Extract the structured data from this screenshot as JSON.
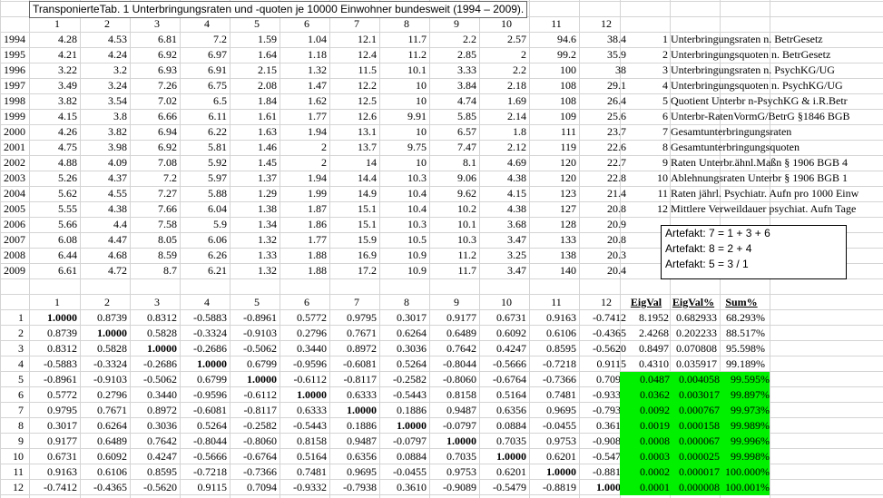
{
  "title": "TransponierteTab. 1 Unterbringungsraten und -quoten je 10000 Einwohner bundesweit (1994 – 2009).",
  "col_headers": [
    "1",
    "2",
    "3",
    "4",
    "5",
    "6",
    "7",
    "8",
    "9",
    "10",
    "11",
    "12"
  ],
  "years": [
    "1994",
    "1995",
    "1996",
    "1997",
    "1998",
    "1999",
    "2000",
    "2001",
    "2002",
    "2003",
    "2004",
    "2005",
    "2006",
    "2007",
    "2008",
    "2009"
  ],
  "data_rows": [
    [
      "4.28",
      "4.53",
      "6.81",
      "7.2",
      "1.59",
      "1.04",
      "12.1",
      "11.7",
      "2.2",
      "2.57",
      "94.6",
      "38.4"
    ],
    [
      "4.21",
      "4.24",
      "6.92",
      "6.97",
      "1.64",
      "1.18",
      "12.4",
      "11.2",
      "2.85",
      "2",
      "99.2",
      "35.9"
    ],
    [
      "3.22",
      "3.2",
      "6.93",
      "6.91",
      "2.15",
      "1.32",
      "11.5",
      "10.1",
      "3.33",
      "2.2",
      "100",
      "38"
    ],
    [
      "3.49",
      "3.24",
      "7.26",
      "6.75",
      "2.08",
      "1.47",
      "12.2",
      "10",
      "3.84",
      "2.18",
      "108",
      "29.1"
    ],
    [
      "3.82",
      "3.54",
      "7.02",
      "6.5",
      "1.84",
      "1.62",
      "12.5",
      "10",
      "4.74",
      "1.69",
      "108",
      "26.4"
    ],
    [
      "4.15",
      "3.8",
      "6.66",
      "6.11",
      "1.61",
      "1.77",
      "12.6",
      "9.91",
      "5.85",
      "2.14",
      "109",
      "25.6"
    ],
    [
      "4.26",
      "3.82",
      "6.94",
      "6.22",
      "1.63",
      "1.94",
      "13.1",
      "10",
      "6.57",
      "1.8",
      "111",
      "23.7"
    ],
    [
      "4.75",
      "3.98",
      "6.92",
      "5.81",
      "1.46",
      "2",
      "13.7",
      "9.75",
      "7.47",
      "2.12",
      "119",
      "22.6"
    ],
    [
      "4.88",
      "4.09",
      "7.08",
      "5.92",
      "1.45",
      "2",
      "14",
      "10",
      "8.1",
      "4.69",
      "120",
      "22.7"
    ],
    [
      "5.26",
      "4.37",
      "7.2",
      "5.97",
      "1.37",
      "1.94",
      "14.4",
      "10.3",
      "9.06",
      "4.38",
      "120",
      "22.8"
    ],
    [
      "5.62",
      "4.55",
      "7.27",
      "5.88",
      "1.29",
      "1.99",
      "14.9",
      "10.4",
      "9.62",
      "4.15",
      "123",
      "21.4"
    ],
    [
      "5.55",
      "4.38",
      "7.66",
      "6.04",
      "1.38",
      "1.87",
      "15.1",
      "10.4",
      "10.2",
      "4.38",
      "127",
      "20.8"
    ],
    [
      "5.66",
      "4.4",
      "7.58",
      "5.9",
      "1.34",
      "1.86",
      "15.1",
      "10.3",
      "10.1",
      "3.68",
      "128",
      "20.9"
    ],
    [
      "6.08",
      "4.47",
      "8.05",
      "6.06",
      "1.32",
      "1.77",
      "15.9",
      "10.5",
      "10.3",
      "3.47",
      "133",
      "20.8"
    ],
    [
      "6.44",
      "4.68",
      "8.59",
      "6.26",
      "1.33",
      "1.88",
      "16.9",
      "10.9",
      "11.2",
      "3.25",
      "138",
      "20.3"
    ],
    [
      "6.61",
      "4.72",
      "8.7",
      "6.21",
      "1.32",
      "1.88",
      "17.2",
      "10.9",
      "11.7",
      "3.47",
      "140",
      "20.4"
    ]
  ],
  "legend": [
    {
      "n": "1",
      "text": "Unterbringungsraten n. BetrGesetz"
    },
    {
      "n": "2",
      "text": "Unterbringungsquoten n. BetrGesetz"
    },
    {
      "n": "3",
      "text": "Unterbringungsraten n. PsychKG/UG"
    },
    {
      "n": "4",
      "text": "Unterbringungsquoten n. PsychKG/UG"
    },
    {
      "n": "5",
      "text": "Quotient Unterbr n-PsychKG & i.R.Betr"
    },
    {
      "n": "6",
      "text": "Unterbr-RatenVormG/BetrG §1846 BGB"
    },
    {
      "n": "7",
      "text": "Gesamtunterbringungsraten"
    },
    {
      "n": "8",
      "text": "Gesamtunterbringungsquoten"
    },
    {
      "n": "9",
      "text": "Raten Unterbr.ähnl.Maßn § 1906 BGB 4"
    },
    {
      "n": "10",
      "text": "Ablehnungsraten Unterbr § 1906 BGB 1"
    },
    {
      "n": "11",
      "text": "Raten jährl. Psychiatr. Aufn pro 1000 Einw"
    },
    {
      "n": "12",
      "text": "Mittlere Verweildauer psychiat. Aufn Tage"
    }
  ],
  "artefacts": [
    "Artefakt: 7 = 1 + 3 + 6",
    "Artefakt: 8 = 2 + 4",
    "Artefakt: 5 = 3 /  1"
  ],
  "corr_headers": [
    "1",
    "2",
    "3",
    "4",
    "5",
    "6",
    "7",
    "8",
    "9",
    "10",
    "11",
    "12"
  ],
  "eig_headers": [
    "EigVal",
    "EigVal%",
    "Sum%"
  ],
  "corr_rows": [
    {
      "label": "1",
      "values": [
        "1.0000",
        "0.8739",
        "0.8312",
        "-0.5883",
        "-0.8961",
        "0.5772",
        "0.9795",
        "0.3017",
        "0.9177",
        "0.6731",
        "0.9163",
        "-0.7412"
      ],
      "eig": [
        "8.1952",
        "0.682933",
        "68.293%"
      ]
    },
    {
      "label": "2",
      "values": [
        "0.8739",
        "1.0000",
        "0.5828",
        "-0.3324",
        "-0.9103",
        "0.2796",
        "0.7671",
        "0.6264",
        "0.6489",
        "0.6092",
        "0.6106",
        "-0.4365"
      ],
      "eig": [
        "2.4268",
        "0.202233",
        "88.517%"
      ]
    },
    {
      "label": "3",
      "values": [
        "0.8312",
        "0.5828",
        "1.0000",
        "-0.2686",
        "-0.5062",
        "0.3440",
        "0.8972",
        "0.3036",
        "0.7642",
        "0.4247",
        "0.8595",
        "-0.5620"
      ],
      "eig": [
        "0.8497",
        "0.070808",
        "95.598%"
      ]
    },
    {
      "label": "4",
      "values": [
        "-0.5883",
        "-0.3324",
        "-0.2686",
        "1.0000",
        "0.6799",
        "-0.9596",
        "-0.6081",
        "0.5264",
        "-0.8044",
        "-0.5666",
        "-0.7218",
        "0.9115"
      ],
      "eig": [
        "0.4310",
        "0.035917",
        "99.189%"
      ]
    },
    {
      "label": "5",
      "values": [
        "-0.8961",
        "-0.9103",
        "-0.5062",
        "0.6799",
        "1.0000",
        "-0.6112",
        "-0.8117",
        "-0.2582",
        "-0.8060",
        "-0.6764",
        "-0.7366",
        "0.7094"
      ],
      "eig": [
        "0.0487",
        "0.004058",
        "99.595%"
      ]
    },
    {
      "label": "6",
      "values": [
        "0.5772",
        "0.2796",
        "0.3440",
        "-0.9596",
        "-0.6112",
        "1.0000",
        "0.6333",
        "-0.5443",
        "0.8158",
        "0.5164",
        "0.7481",
        "-0.9332"
      ],
      "eig": [
        "0.0362",
        "0.003017",
        "99.897%"
      ]
    },
    {
      "label": "7",
      "values": [
        "0.9795",
        "0.7671",
        "0.8972",
        "-0.6081",
        "-0.8117",
        "0.6333",
        "1.0000",
        "0.1886",
        "0.9487",
        "0.6356",
        "0.9695",
        "-0.7938"
      ],
      "eig": [
        "0.0092",
        "0.000767",
        "99.973%"
      ]
    },
    {
      "label": "8",
      "values": [
        "0.3017",
        "0.6264",
        "0.3036",
        "0.5264",
        "-0.2582",
        "-0.5443",
        "0.1886",
        "1.0000",
        "-0.0797",
        "0.0884",
        "-0.0455",
        "0.3610"
      ],
      "eig": [
        "0.0019",
        "0.000158",
        "99.989%"
      ]
    },
    {
      "label": "9",
      "values": [
        "0.9177",
        "0.6489",
        "0.7642",
        "-0.8044",
        "-0.8060",
        "0.8158",
        "0.9487",
        "-0.0797",
        "1.0000",
        "0.7035",
        "0.9753",
        "-0.9089"
      ],
      "eig": [
        "0.0008",
        "0.000067",
        "99.996%"
      ]
    },
    {
      "label": "10",
      "values": [
        "0.6731",
        "0.6092",
        "0.4247",
        "-0.5666",
        "-0.6764",
        "0.5164",
        "0.6356",
        "0.0884",
        "0.7035",
        "1.0000",
        "0.6201",
        "-0.5479"
      ],
      "eig": [
        "0.0003",
        "0.000025",
        "99.998%"
      ]
    },
    {
      "label": "11",
      "values": [
        "0.9163",
        "0.6106",
        "0.8595",
        "-0.7218",
        "-0.7366",
        "0.7481",
        "0.9695",
        "-0.0455",
        "0.9753",
        "0.6201",
        "1.0000",
        "-0.8819"
      ],
      "eig": [
        "0.0002",
        "0.000017",
        "100.000%"
      ]
    },
    {
      "label": "12",
      "values": [
        "-0.7412",
        "-0.4365",
        "-0.5620",
        "0.9115",
        "0.7094",
        "-0.9332",
        "-0.7938",
        "0.3610",
        "-0.9089",
        "-0.5479",
        "-0.8819",
        "1.0000"
      ],
      "eig": [
        "0.0001",
        "0.000008",
        "100.001%"
      ]
    }
  ],
  "colors": {
    "highlight": "#00f000",
    "grid": "#d4d4d4"
  }
}
